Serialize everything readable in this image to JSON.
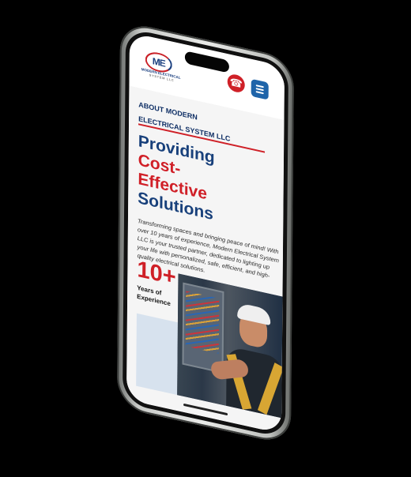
{
  "brand": {
    "logo_mark": "ME",
    "name": "MODERN ELECTRICAL",
    "subline": "SYSTEM LLC"
  },
  "header": {
    "call_icon": "phone-icon",
    "menu_icon": "menu-icon"
  },
  "about": {
    "line1": "ABOUT MODERN",
    "line2": "ELECTRICAL SYSTEM LLC"
  },
  "headline": {
    "line1": "Providing",
    "line2": "Cost-",
    "line3": "Effective",
    "line4": "Solutions"
  },
  "body": {
    "text": "Transforming spaces and bringing peace of mind! With over 10 years of experience, Modern Electrical System LLC is your trusted partner, dedicated to lighting up your life with personalized, safe, efficient, and high-quality electrical solutions."
  },
  "stat": {
    "number": "10+",
    "label_line1": "Years of",
    "label_line2": "Experience"
  },
  "colors": {
    "brand_blue": "#18407b",
    "brand_red": "#d01f27",
    "menu_blue": "#1f64a9"
  }
}
